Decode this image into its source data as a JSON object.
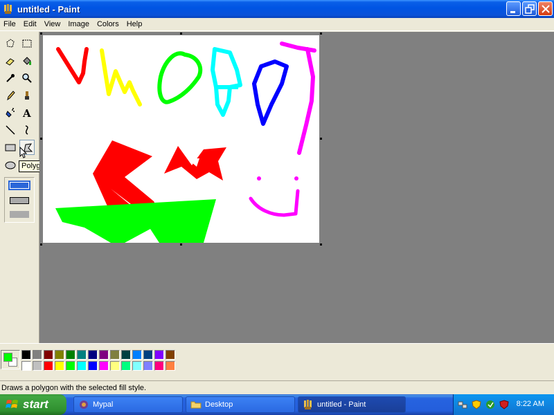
{
  "window": {
    "title": "untitled - Paint"
  },
  "menu": [
    "File",
    "Edit",
    "View",
    "Image",
    "Colors",
    "Help"
  ],
  "tools": [
    {
      "name": "free-form-select-icon"
    },
    {
      "name": "select-icon"
    },
    {
      "name": "eraser-icon"
    },
    {
      "name": "fill-bucket-icon"
    },
    {
      "name": "pick-color-icon"
    },
    {
      "name": "magnifier-icon"
    },
    {
      "name": "pencil-icon"
    },
    {
      "name": "brush-icon"
    },
    {
      "name": "airbrush-icon"
    },
    {
      "name": "text-icon"
    },
    {
      "name": "line-icon"
    },
    {
      "name": "curve-icon"
    },
    {
      "name": "rectangle-icon"
    },
    {
      "name": "polygon-icon"
    },
    {
      "name": "ellipse-icon"
    },
    {
      "name": "rounded-rectangle-icon"
    }
  ],
  "tooltip": "Polygon",
  "current_colors": {
    "foreground": "#00ff00",
    "background": "#ffffff"
  },
  "palette": {
    "top": [
      "#000000",
      "#808080",
      "#800000",
      "#808000",
      "#008000",
      "#008080",
      "#000080",
      "#800080",
      "#808040",
      "#004040",
      "#0080ff",
      "#004080",
      "#8000ff",
      "#804000"
    ],
    "bottom": [
      "#ffffff",
      "#c0c0c0",
      "#ff0000",
      "#ffff00",
      "#00ff00",
      "#00ffff",
      "#0000ff",
      "#ff00ff",
      "#ffff80",
      "#00ff80",
      "#80ffff",
      "#8080ff",
      "#ff0080",
      "#ff8040"
    ]
  },
  "status": "Draws a polygon with the selected fill style.",
  "taskbar": {
    "start_label": "start",
    "tasks": [
      {
        "label": "Mypal",
        "active": false
      },
      {
        "label": "Desktop",
        "active": false
      },
      {
        "label": "untitled - Paint",
        "active": true
      }
    ],
    "clock": "8:22 AM"
  }
}
